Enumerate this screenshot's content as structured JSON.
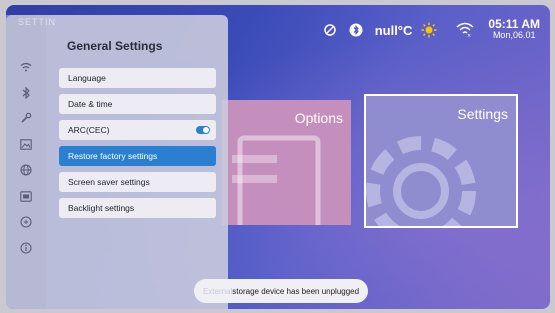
{
  "overlay": {
    "faint_title": "SETTIN"
  },
  "status": {
    "weather_text": "null°C",
    "time": "05:11 AM",
    "date": "Mon,06.01",
    "icons": [
      "no-signal-icon",
      "bluetooth-icon",
      "sun-icon",
      "wifi-icon"
    ]
  },
  "cards": [
    {
      "label": "Options"
    },
    {
      "label": "Settings"
    }
  ],
  "panel": {
    "title": "General Settings",
    "rail_icons": [
      "wifi-icon",
      "bluetooth-icon",
      "wrench-icon",
      "image-icon",
      "globe-icon",
      "display-icon",
      "power-icon",
      "info-icon"
    ],
    "items": [
      {
        "label": "Language"
      },
      {
        "label": "Date & time"
      },
      {
        "label": "ARC(CEC)",
        "toggle": "on"
      },
      {
        "label": "Restore factory settings",
        "selected": true
      },
      {
        "label": "Screen saver settings"
      },
      {
        "label": "Backlight settings"
      }
    ]
  },
  "toast": {
    "faded_prefix": "External",
    "text": " storage device has been unplugged"
  },
  "colors": {
    "accent": "#2a7fd0",
    "panel": "#cdcdde"
  }
}
